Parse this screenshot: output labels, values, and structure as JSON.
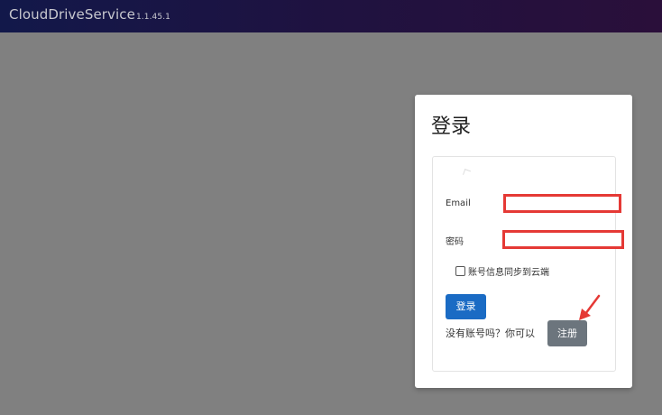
{
  "header": {
    "app_name": "CloudDriveService",
    "version": "1.1.45.1"
  },
  "login_modal": {
    "title": "登录",
    "email_label": "Email",
    "email_value": "",
    "password_label": "密码",
    "password_value": "",
    "remember_label": "账号信息同步到云端",
    "remember_checked": false,
    "login_button": "登录",
    "no_account_text": "没有账号吗？你可以",
    "register_button": "注册"
  },
  "annotations": {
    "highlight_color": "#e53935",
    "arrow_target": "register_button"
  }
}
